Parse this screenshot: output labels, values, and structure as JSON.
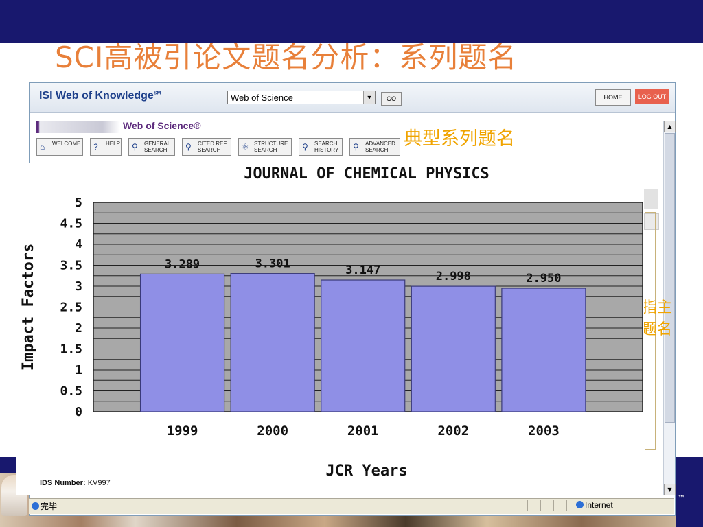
{
  "slide": {
    "title": "SCI高被引论文题名分析：系列题名",
    "annotation_typical": "典型系列题名",
    "annotation_clipped_line1": "指主",
    "annotation_clipped_line2": "题名",
    "trademark": "™"
  },
  "browser": {
    "isi_logo": "ISI Web of Knowledge",
    "isi_logo_mark": "SM",
    "database_select_value": "Web of Science",
    "go_label": "GO",
    "home_label": "HOME",
    "logout_label": "LOG OUT",
    "wos_title": "Web of Science®",
    "nav_buttons": [
      {
        "label": "WELCOME",
        "icon": "home-icon"
      },
      {
        "label": "HELP",
        "icon": "help-icon"
      },
      {
        "label": "GENERAL\nSEARCH",
        "icon": "search-icon"
      },
      {
        "label": "CITED REF\nSEARCH",
        "icon": "search-icon"
      },
      {
        "label": "STRUCTURE\nSEARCH",
        "icon": "structure-icon"
      },
      {
        "label": "SEARCH\nHISTORY",
        "icon": "search-icon"
      },
      {
        "label": "ADVANCED\nSEARCH",
        "icon": "search-icon"
      }
    ],
    "ids_label": "IDS Number:",
    "ids_value": "KV997",
    "status_text": "完毕",
    "zone_text": "Internet"
  },
  "chart_data": {
    "type": "bar",
    "title": "JOURNAL OF CHEMICAL PHYSICS",
    "xlabel": "JCR Years",
    "ylabel": "Impact Factors",
    "categories": [
      "1999",
      "2000",
      "2001",
      "2002",
      "2003"
    ],
    "values": [
      3.289,
      3.301,
      3.147,
      2.998,
      2.95
    ],
    "value_labels": [
      "3.289",
      "3.301",
      "3.147",
      "2.998",
      "2.950"
    ],
    "ylim": [
      0,
      5
    ],
    "yticks": [
      "0",
      "0.5",
      "1",
      "1.5",
      "2",
      "2.5",
      "3",
      "3.5",
      "4",
      "4.5",
      "5"
    ],
    "grid": true,
    "bar_color": "#8f8fe6",
    "plot_background": "#a8a8a8"
  }
}
